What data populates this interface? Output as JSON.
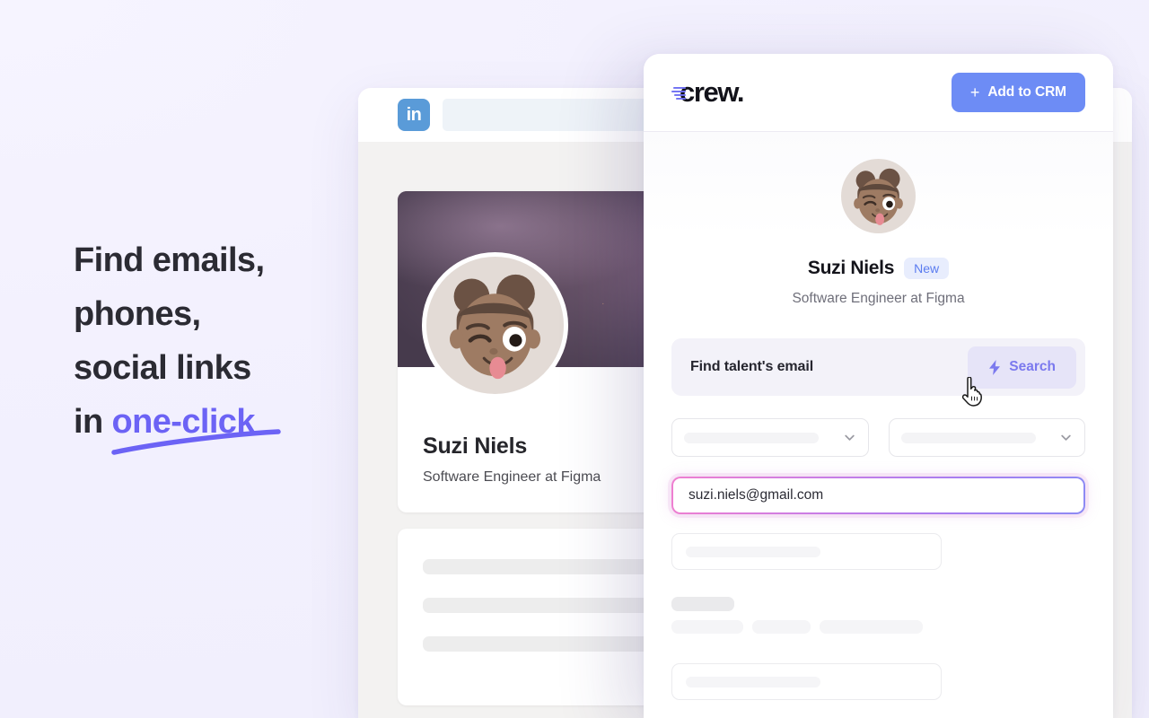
{
  "hero": {
    "line1": "Find emails,",
    "line2": "phones,",
    "line3": "social links",
    "line4_prefix": "in ",
    "line4_accent": "one-click",
    "accent_color": "#6c63f5",
    "text_color": "#2b2b33"
  },
  "background_window": {
    "site_icon": "linkedin-icon",
    "site_icon_label": "in",
    "search_placeholder": "",
    "profile": {
      "name": "Suzi Niels",
      "headline": "Software Engineer at Figma",
      "avatar": "memoji-avatar"
    }
  },
  "extension": {
    "brand": {
      "name": "crew.",
      "mark": "crew-speed-lines-icon"
    },
    "add_to_crm": {
      "label": "Add to CRM",
      "plus_icon": "plus-icon",
      "color": "#6d8cf5"
    },
    "profile": {
      "avatar": "memoji-avatar",
      "name": "Suzi Niels",
      "badge": "New",
      "badge_bg": "#e8edfd",
      "badge_color": "#5b7cf0",
      "role": "Software Engineer at Figma"
    },
    "find_email": {
      "label": "Find talent's email",
      "search_label": "Search",
      "search_icon": "lightning-bolt-icon",
      "search_color": "#7b79ee",
      "search_bg": "#e6e4f8",
      "row_bg": "#f3f2f9"
    },
    "selects": [
      {
        "name": "select-left",
        "value": "",
        "icon": "chevron-down-icon"
      },
      {
        "name": "select-right",
        "value": "",
        "icon": "chevron-down-icon"
      }
    ],
    "email_result": {
      "value": "suzi.niels@gmail.com",
      "state": "highlighted",
      "border_gradient_from": "#ef7fd0",
      "border_gradient_to": "#8d8af4"
    },
    "skeleton_rows": [
      {
        "name": "ghost-input-top",
        "value": ""
      },
      {
        "name": "ghost-input-bottom",
        "value": ""
      }
    ]
  },
  "cursor": {
    "type": "pointer-hand-cursor"
  }
}
